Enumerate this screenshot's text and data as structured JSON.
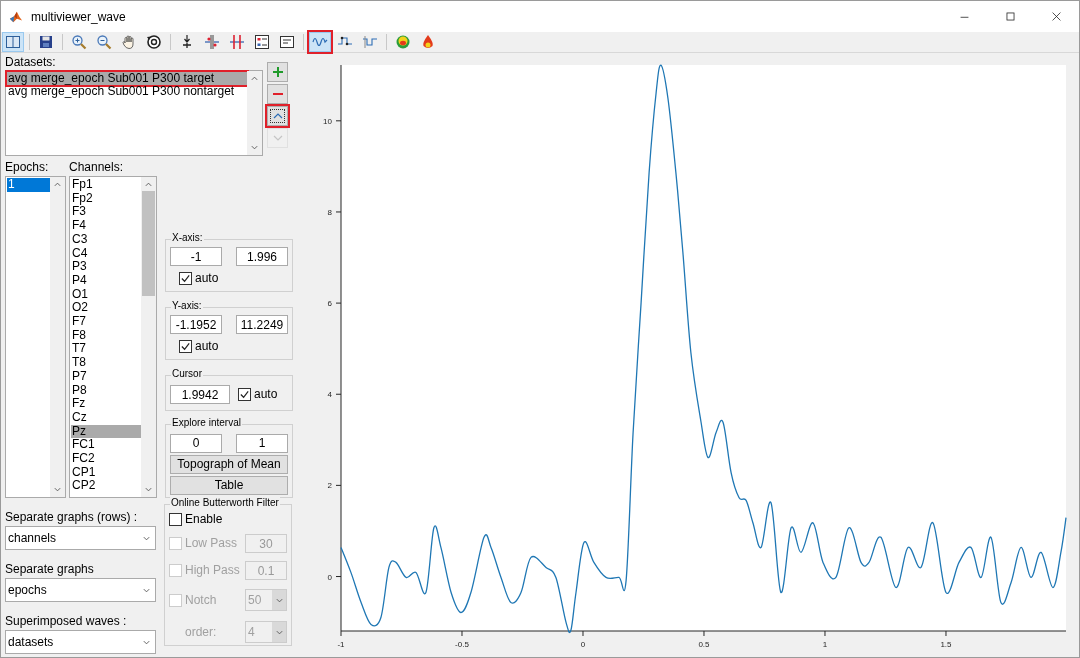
{
  "window": {
    "title": "multiviewer_wave"
  },
  "toolbar": [
    {
      "kind": "panels",
      "selected": true,
      "annotated": false
    },
    {
      "kind": "separator"
    },
    {
      "kind": "save",
      "selected": false,
      "annotated": false
    },
    {
      "kind": "separator"
    },
    {
      "kind": "zoom-in",
      "selected": false,
      "annotated": false
    },
    {
      "kind": "zoom-out",
      "selected": false,
      "annotated": false
    },
    {
      "kind": "pan",
      "selected": false,
      "annotated": false
    },
    {
      "kind": "rotate",
      "selected": false,
      "annotated": false
    },
    {
      "kind": "separator"
    },
    {
      "kind": "insert",
      "selected": false,
      "annotated": false
    },
    {
      "kind": "marker",
      "selected": false,
      "annotated": false
    },
    {
      "kind": "marker-2",
      "selected": false,
      "annotated": false
    },
    {
      "kind": "legend",
      "selected": false,
      "annotated": false
    },
    {
      "kind": "textbox",
      "selected": false,
      "annotated": false
    },
    {
      "kind": "separator"
    },
    {
      "kind": "wave",
      "selected": true,
      "annotated": true
    },
    {
      "kind": "wave-points",
      "selected": false,
      "annotated": false
    },
    {
      "kind": "wave-steps",
      "selected": false,
      "annotated": false
    },
    {
      "kind": "separator"
    },
    {
      "kind": "head",
      "selected": false,
      "annotated": false
    },
    {
      "kind": "drop",
      "selected": false,
      "annotated": false
    }
  ],
  "datasets": {
    "label": "Datasets:",
    "items": [
      {
        "text": "avg merge_epoch Sub001 P300 target",
        "selected": true,
        "annotated": true
      },
      {
        "text": "avg merge_epoch Sub001 P300 nontarget",
        "selected": false,
        "annotated": false
      }
    ]
  },
  "dataset_buttons": [
    {
      "kind": "add",
      "disabled": false,
      "focused": false,
      "annotated": false
    },
    {
      "kind": "remove",
      "disabled": false,
      "focused": false,
      "annotated": false
    },
    {
      "kind": "up",
      "disabled": false,
      "focused": true,
      "annotated": true
    },
    {
      "kind": "down",
      "disabled": true,
      "focused": false,
      "annotated": false
    }
  ],
  "epochs": {
    "label": "Epochs:",
    "items": [
      {
        "text": "1",
        "selected": true
      }
    ]
  },
  "channels": {
    "label": "Channels:",
    "items": [
      {
        "text": "Fp1",
        "selected": false
      },
      {
        "text": "Fp2",
        "selected": false
      },
      {
        "text": "F3",
        "selected": false
      },
      {
        "text": "F4",
        "selected": false
      },
      {
        "text": "C3",
        "selected": false
      },
      {
        "text": "C4",
        "selected": false
      },
      {
        "text": "P3",
        "selected": false
      },
      {
        "text": "P4",
        "selected": false
      },
      {
        "text": "O1",
        "selected": false
      },
      {
        "text": "O2",
        "selected": false
      },
      {
        "text": "F7",
        "selected": false
      },
      {
        "text": "F8",
        "selected": false
      },
      {
        "text": "T7",
        "selected": false
      },
      {
        "text": "T8",
        "selected": false
      },
      {
        "text": "P7",
        "selected": false
      },
      {
        "text": "P8",
        "selected": false
      },
      {
        "text": "Fz",
        "selected": false
      },
      {
        "text": "Cz",
        "selected": false
      },
      {
        "text": "Pz",
        "selected": true
      },
      {
        "text": "FC1",
        "selected": false
      },
      {
        "text": "FC2",
        "selected": false
      },
      {
        "text": "CP1",
        "selected": false
      },
      {
        "text": "CP2",
        "selected": false
      }
    ]
  },
  "x_axis": {
    "title": "X-axis:",
    "min": "-1",
    "max": "1.996",
    "auto": {
      "label": "auto",
      "checked": true
    }
  },
  "y_axis": {
    "title": "Y-axis:",
    "min": "-1.1952",
    "max": "11.2249",
    "auto": {
      "label": "auto",
      "checked": true
    }
  },
  "cursor": {
    "title": "Cursor",
    "value": "1.9942",
    "auto": {
      "label": "auto",
      "checked": true
    }
  },
  "explore_interval": {
    "title": "Explore interval",
    "from": "0",
    "to": "1",
    "buttons": [
      "Topograph of Mean",
      "Table"
    ]
  },
  "selectors": [
    {
      "label": "Separate graphs (rows) :",
      "value": "channels"
    },
    {
      "label": "Separate graphs",
      "value": "epochs"
    },
    {
      "label": "Superimposed waves :",
      "value": "datasets"
    }
  ],
  "filter": {
    "title": "Online Butterworth Filter",
    "enable": {
      "label": "Enable",
      "checked": false
    },
    "rows": [
      {
        "kind": "check_field",
        "label": "Low Pass",
        "checked": false,
        "disabled": true,
        "value": "30"
      },
      {
        "kind": "check_field",
        "label": "High Pass",
        "checked": false,
        "disabled": true,
        "value": "0.1"
      },
      {
        "kind": "check_dropdown",
        "label": "Notch",
        "checked": false,
        "disabled": true,
        "value": "50"
      },
      {
        "kind": "dropdown",
        "label": "order:",
        "disabled": true,
        "value": "4"
      }
    ]
  },
  "plot": {
    "chart_data": {
      "type": "line",
      "xlim": [
        -1,
        1.996
      ],
      "ylim": [
        -1.1952,
        11.2249
      ],
      "xticks": [
        -1,
        -0.5,
        0,
        0.5,
        1,
        1.5
      ],
      "yticks": [
        0,
        2,
        4,
        6,
        8,
        10
      ],
      "x": [
        -1,
        -0.959,
        -0.917,
        -0.876,
        -0.835,
        -0.802,
        -0.773,
        -0.731,
        -0.69,
        -0.649,
        -0.616,
        -0.587,
        -0.545,
        -0.504,
        -0.463,
        -0.409,
        -0.38,
        -0.339,
        -0.298,
        -0.256,
        -0.215,
        -0.153,
        -0.112,
        -0.07,
        -0.05,
        -0.029,
        0.004,
        0.045,
        0.095,
        0.149,
        0.178,
        0.207,
        0.24,
        0.273,
        0.302,
        0.322,
        0.351,
        0.384,
        0.413,
        0.446,
        0.488,
        0.517,
        0.55,
        0.579,
        0.612,
        0.645,
        0.674,
        0.702,
        0.736,
        0.777,
        0.818,
        0.86,
        0.901,
        0.95,
        0.992,
        1.045,
        1.099,
        1.149,
        1.182,
        1.231,
        1.293,
        1.343,
        1.397,
        1.446,
        1.5,
        1.554,
        1.603,
        1.645,
        1.686,
        1.727,
        1.769,
        1.81,
        1.851,
        1.893,
        1.942,
        1.975,
        1.996
      ],
      "series": [
        {
          "color": "#1f77b4",
          "values": [
            0.64,
            0.09,
            -0.57,
            -1.05,
            -0.9,
            0.2,
            0.31,
            -0.02,
            0.09,
            -0.35,
            1.07,
            0.64,
            -0.35,
            -0.79,
            -0.35,
            0.86,
            0.64,
            -0.02,
            -0.57,
            -0.35,
            0.42,
            0.2,
            -0.02,
            -1.01,
            -1.18,
            -0.35,
            0.75,
            0.31,
            -0.02,
            -0.02,
            -0.09,
            3.16,
            6.01,
            8.86,
            10.61,
            11.22,
            10.5,
            8.86,
            7.11,
            4.91,
            3.38,
            2.61,
            3.16,
            3.38,
            2.28,
            1.73,
            1.67,
            1.18,
            0.64,
            1.62,
            -0.35,
            1.07,
            0.53,
            1.18,
            0.31,
            -0.02,
            1.07,
            0.31,
            0.31,
            0.86,
            -0.24,
            0.64,
            0.2,
            1.18,
            -0.35,
            0.31,
            0.64,
            -0.02,
            0.86,
            -0.57,
            -0.13,
            0.64,
            -0.02,
            0.53,
            -0.24,
            0.53,
            1.29
          ]
        }
      ]
    }
  }
}
